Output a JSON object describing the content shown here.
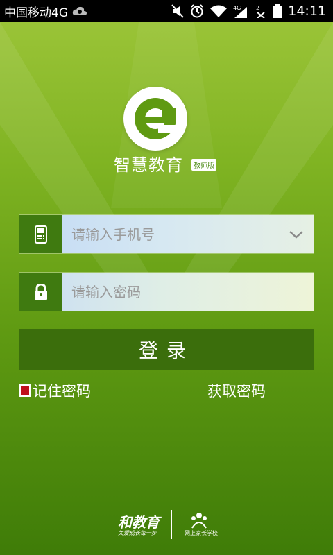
{
  "status_bar": {
    "carrier": "中国移动4G",
    "time": "14:11",
    "icons": [
      "cloud-icon",
      "mute-icon",
      "alarm-icon",
      "wifi-icon",
      "signal-4g-icon",
      "signal-2-icon",
      "battery-icon"
    ]
  },
  "app": {
    "name": "智慧教育",
    "badge": "教师版"
  },
  "form": {
    "phone_placeholder": "请输入手机号",
    "password_placeholder": "请输入密码",
    "login_label": "登录",
    "remember_label": "记住密码",
    "remember_checked": true,
    "get_password_label": "获取密码"
  },
  "footer": {
    "brand1": "和教育",
    "brand1_slogan": "关爱成长每一步",
    "brand2": "网上家长学校"
  },
  "colors": {
    "bg_top": "#9ec63a",
    "bg_bottom": "#3f7c08",
    "icon_block": "#3f7a10",
    "button": "#3b6e0c",
    "checkbox": "#c0101c"
  }
}
